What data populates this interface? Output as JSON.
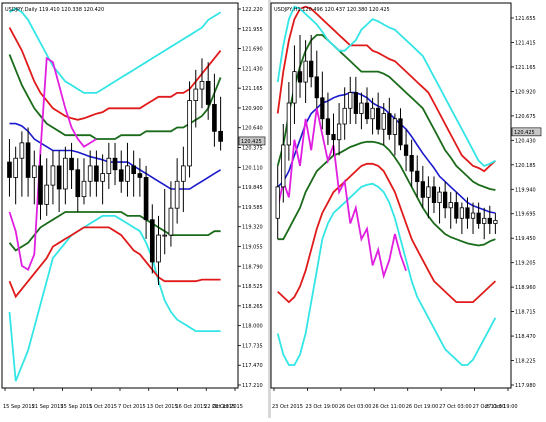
{
  "colors": {
    "background": "#ffffff",
    "frame": "#000000",
    "separator": "#d8d8d8",
    "bull_candle": "#ffffff",
    "bear_candle": "#000000",
    "band_outer": "#33e5e5",
    "band_mid": "#e01a1a",
    "band_inner": "#1a6b1a",
    "moving_average": "#1a1acc",
    "lagging_span": "#e01ee0",
    "price_box": "#c8c8c8"
  },
  "chart_data": [
    {
      "type": "line",
      "instrument_label": "USDJPY,Daily 119.410 120.338 120.420",
      "y_ticks": [
        "122.220",
        "121.955",
        "121.690",
        "121.430",
        "121.165",
        "120.900",
        "120.640",
        "120.375",
        "120.110",
        "119.845",
        "119.585",
        "119.320",
        "119.055",
        "118.790",
        "118.525",
        "118.265",
        "118.000",
        "117.735",
        "117.470",
        "117.210"
      ],
      "ylim": [
        117.21,
        122.22
      ],
      "x_ticks": [
        "15 Sep 2015",
        "21 Sep 2015",
        "25 Sep 2015",
        "1 Oct 2015",
        "7 Oct 2015",
        "13 Oct 2015",
        "16 Oct 2015",
        "22 Oct 2015",
        "28 Oct 2015"
      ],
      "current_price": "120.425",
      "candles": {
        "open": [
          120.15,
          119.95,
          120.2,
          120.4,
          119.95,
          120.1,
          119.6,
          119.85,
          120.1,
          119.8,
          120.2,
          120.05,
          119.7,
          119.9,
          120.1,
          119.9,
          120.0,
          120.2,
          120.05,
          119.9,
          120.1,
          120.0,
          119.95,
          119.4,
          118.85,
          119.2,
          119.2,
          119.55,
          119.9,
          120.1,
          120.95,
          121.1,
          121.2,
          120.9,
          120.55
        ],
        "high": [
          120.45,
          120.35,
          120.55,
          120.6,
          120.3,
          120.25,
          120.2,
          120.3,
          120.3,
          120.35,
          120.4,
          120.2,
          120.2,
          120.3,
          120.3,
          120.25,
          120.4,
          120.4,
          120.3,
          120.4,
          120.3,
          120.2,
          120.1,
          119.6,
          119.45,
          119.8,
          119.9,
          120.2,
          120.35,
          121.2,
          121.35,
          121.5,
          121.45,
          121.3,
          121.0
        ],
        "low": [
          119.7,
          119.6,
          119.7,
          119.7,
          119.6,
          119.4,
          119.45,
          119.6,
          119.5,
          119.6,
          119.8,
          119.5,
          119.6,
          119.7,
          119.7,
          119.6,
          119.8,
          119.85,
          119.75,
          119.7,
          119.7,
          119.7,
          119.15,
          118.7,
          118.55,
          118.95,
          119.05,
          119.35,
          119.5,
          119.95,
          120.6,
          120.85,
          120.7,
          120.35,
          120.3
        ],
        "close": [
          119.95,
          120.2,
          120.4,
          119.95,
          120.1,
          119.6,
          119.85,
          120.1,
          119.8,
          120.2,
          120.05,
          119.7,
          119.9,
          120.1,
          119.9,
          120.0,
          120.2,
          120.05,
          119.9,
          120.1,
          120.0,
          119.95,
          119.4,
          118.85,
          119.2,
          119.2,
          119.55,
          119.9,
          120.1,
          120.95,
          121.1,
          121.2,
          120.9,
          120.55,
          120.42
        ]
      },
      "series": [
        {
          "name": "",
          "role": "band_outer",
          "values": [
            118.2,
            117.3,
            117.5,
            117.7,
            118.0,
            118.3,
            118.6,
            118.9,
            119.0,
            119.1,
            119.2,
            119.25,
            119.3,
            119.35,
            119.4,
            119.45,
            119.45,
            119.45,
            119.4,
            119.35,
            119.3,
            119.25,
            119.1,
            118.9,
            118.6,
            118.35,
            118.2,
            118.1,
            118.05,
            118.0,
            117.95,
            117.95,
            117.95,
            117.95,
            117.95
          ]
        },
        {
          "name": "",
          "role": "band_mid",
          "values": [
            118.6,
            118.4,
            118.5,
            118.6,
            118.7,
            118.8,
            118.9,
            119.05,
            119.1,
            119.15,
            119.2,
            119.25,
            119.3,
            119.3,
            119.3,
            119.3,
            119.3,
            119.25,
            119.2,
            119.1,
            119.0,
            118.95,
            118.85,
            118.75,
            118.65,
            118.6,
            118.6,
            118.6,
            118.6,
            118.6,
            118.6,
            118.62,
            118.62,
            118.62,
            118.62
          ]
        },
        {
          "name": "",
          "role": "band_inner",
          "values": [
            119.1,
            119.0,
            119.05,
            119.1,
            119.2,
            119.3,
            119.35,
            119.4,
            119.45,
            119.5,
            119.5,
            119.5,
            119.5,
            119.5,
            119.5,
            119.5,
            119.5,
            119.5,
            119.5,
            119.45,
            119.45,
            119.45,
            119.4,
            119.35,
            119.3,
            119.25,
            119.2,
            119.2,
            119.2,
            119.2,
            119.2,
            119.2,
            119.2,
            119.25,
            119.25
          ]
        },
        {
          "name": "",
          "role": "moving_average",
          "values": [
            120.65,
            120.65,
            120.62,
            120.55,
            120.45,
            120.4,
            120.35,
            120.3,
            120.3,
            120.3,
            120.3,
            120.28,
            120.25,
            120.22,
            120.2,
            120.18,
            120.15,
            120.15,
            120.15,
            120.15,
            120.1,
            120.05,
            120.0,
            119.95,
            119.9,
            119.85,
            119.8,
            119.8,
            119.8,
            119.8,
            119.85,
            119.9,
            119.95,
            120.0,
            120.05
          ]
        },
        {
          "name": "",
          "role": "band_inner",
          "values": [
            121.55,
            121.35,
            121.15,
            121.0,
            120.85,
            120.75,
            120.65,
            120.6,
            120.55,
            120.5,
            120.5,
            120.5,
            120.5,
            120.5,
            120.45,
            120.45,
            120.45,
            120.45,
            120.5,
            120.5,
            120.5,
            120.5,
            120.55,
            120.55,
            120.55,
            120.55,
            120.55,
            120.6,
            120.6,
            120.65,
            120.7,
            120.75,
            120.85,
            121.05,
            121.25
          ]
        },
        {
          "name": "",
          "role": "band_mid",
          "values": [
            121.9,
            121.75,
            121.6,
            121.4,
            121.2,
            121.05,
            120.95,
            120.85,
            120.8,
            120.75,
            120.72,
            120.7,
            120.72,
            120.75,
            120.78,
            120.8,
            120.85,
            120.85,
            120.85,
            120.85,
            120.85,
            120.85,
            120.9,
            120.95,
            121.0,
            121.0,
            121.0,
            121.05,
            121.05,
            121.1,
            121.2,
            121.3,
            121.4,
            121.5,
            121.6
          ]
        },
        {
          "name": "",
          "role": "band_outer",
          "values": [
            122.1,
            122.15,
            122.1,
            122.0,
            121.85,
            121.7,
            121.55,
            121.4,
            121.3,
            121.2,
            121.15,
            121.1,
            121.05,
            121.05,
            121.05,
            121.1,
            121.15,
            121.2,
            121.25,
            121.3,
            121.35,
            121.4,
            121.45,
            121.5,
            121.55,
            121.6,
            121.65,
            121.7,
            121.75,
            121.8,
            121.85,
            121.9,
            122.0,
            122.05,
            122.1
          ]
        }
      ],
      "lagging_span": [
        119.5,
        119.25,
        118.8,
        118.75,
        118.95,
        120.3,
        121.5,
        121.45,
        121.15,
        120.85,
        120.6,
        120.45,
        120.35,
        120.4,
        120.45
      ]
    },
    {
      "type": "line",
      "instrument_label": "USDJPY,H1 120.496 120.437 120.380 120.425",
      "y_ticks": [
        "121.655",
        "121.415",
        "121.165",
        "120.920",
        "120.675",
        "120.430",
        "120.185",
        "119.940",
        "119.695",
        "119.450",
        "119.205",
        "118.960",
        "118.715",
        "118.470",
        "118.225",
        "117.980"
      ],
      "ylim": [
        117.98,
        121.655
      ],
      "x_ticks": [
        "23 Oct 2015",
        "23 Oct 19:00",
        "26 Oct 03:00",
        "26 Oct 11:00",
        "26 Oct 19:00",
        "27 Oct 03:00",
        "27 Oct 11:00",
        "27 Oct 19:00"
      ],
      "current_price": "120.425",
      "candles": {
        "open": [
          119.6,
          119.9,
          120.3,
          120.7,
          121.0,
          120.9,
          121.1,
          120.95,
          120.75,
          120.55,
          120.4,
          120.35,
          120.5,
          120.65,
          120.8,
          120.6,
          120.7,
          120.55,
          120.65,
          120.45,
          120.6,
          120.4,
          120.55,
          120.3,
          120.2,
          120.05,
          119.95,
          119.8,
          119.9,
          119.75,
          119.85,
          119.7,
          119.75,
          119.6,
          119.7,
          119.6,
          119.65,
          119.55,
          119.6,
          119.55
        ],
        "high": [
          120.1,
          120.5,
          120.9,
          121.25,
          121.35,
          121.3,
          121.35,
          121.2,
          121.0,
          120.8,
          120.6,
          120.7,
          120.85,
          120.95,
          120.95,
          120.8,
          120.85,
          120.75,
          120.8,
          120.7,
          120.75,
          120.6,
          120.65,
          120.45,
          120.35,
          120.2,
          120.1,
          120.0,
          120.0,
          119.9,
          119.95,
          119.85,
          119.85,
          119.75,
          119.8,
          119.75,
          119.75,
          119.7,
          119.72,
          119.65
        ],
        "low": [
          119.4,
          119.75,
          120.15,
          120.5,
          120.75,
          120.7,
          120.85,
          120.65,
          120.45,
          120.3,
          120.2,
          120.2,
          120.35,
          120.5,
          120.5,
          120.45,
          120.5,
          120.4,
          120.4,
          120.3,
          120.35,
          120.2,
          120.25,
          120.05,
          119.9,
          119.8,
          119.7,
          119.6,
          119.65,
          119.55,
          119.6,
          119.5,
          119.55,
          119.45,
          119.5,
          119.45,
          119.5,
          119.4,
          119.45,
          119.45
        ],
        "close": [
          119.9,
          120.3,
          120.7,
          121.0,
          120.9,
          121.1,
          120.95,
          120.75,
          120.55,
          120.4,
          120.35,
          120.5,
          120.65,
          120.8,
          120.6,
          120.7,
          120.55,
          120.65,
          120.45,
          120.6,
          120.4,
          120.55,
          120.3,
          120.2,
          120.05,
          119.95,
          119.8,
          119.9,
          119.75,
          119.85,
          119.7,
          119.75,
          119.6,
          119.7,
          119.6,
          119.65,
          119.55,
          119.6,
          119.55,
          119.58
        ]
      },
      "series": [
        {
          "name": "",
          "role": "band_outer",
          "values": [
            118.5,
            118.3,
            118.2,
            118.2,
            118.3,
            118.5,
            118.8,
            119.1,
            119.4,
            119.55,
            119.65,
            119.7,
            119.75,
            119.8,
            119.85,
            119.9,
            119.92,
            119.93,
            119.9,
            119.85,
            119.75,
            119.6,
            119.4,
            119.2,
            119.0,
            118.85,
            118.75,
            118.65,
            118.55,
            118.45,
            118.35,
            118.3,
            118.25,
            118.2,
            118.2,
            118.25,
            118.35,
            118.45,
            118.55,
            118.65
          ]
        },
        {
          "name": "",
          "role": "band_mid",
          "values": [
            118.9,
            118.85,
            118.8,
            118.85,
            118.95,
            119.1,
            119.3,
            119.5,
            119.65,
            119.75,
            119.85,
            119.9,
            119.95,
            120.0,
            120.05,
            120.1,
            120.12,
            120.12,
            120.1,
            120.05,
            119.95,
            119.85,
            119.7,
            119.55,
            119.4,
            119.3,
            119.2,
            119.1,
            119.0,
            118.95,
            118.9,
            118.85,
            118.8,
            118.8,
            118.8,
            118.8,
            118.85,
            118.9,
            118.95,
            119.0
          ]
        },
        {
          "name": "",
          "role": "band_inner",
          "values": [
            119.4,
            119.4,
            119.5,
            119.6,
            119.7,
            119.85,
            119.95,
            120.05,
            120.1,
            120.15,
            120.2,
            120.22,
            120.25,
            120.28,
            120.3,
            120.32,
            120.33,
            120.33,
            120.32,
            120.3,
            120.25,
            120.18,
            120.1,
            120.0,
            119.9,
            119.8,
            119.7,
            119.62,
            119.55,
            119.5,
            119.45,
            119.42,
            119.4,
            119.38,
            119.36,
            119.35,
            119.34,
            119.35,
            119.38,
            119.4
          ]
        },
        {
          "name": "",
          "role": "moving_average",
          "values": [
            119.9,
            119.95,
            120.05,
            120.2,
            120.35,
            120.5,
            120.6,
            120.65,
            120.7,
            120.72,
            120.75,
            120.77,
            120.78,
            120.8,
            120.8,
            120.78,
            120.75,
            120.7,
            120.67,
            120.65,
            120.6,
            120.55,
            120.5,
            120.45,
            120.38,
            120.3,
            120.22,
            120.15,
            120.08,
            120.0,
            119.95,
            119.9,
            119.85,
            119.8,
            119.75,
            119.72,
            119.7,
            119.68,
            119.66,
            119.65
          ]
        },
        {
          "name": "",
          "role": "band_inner",
          "values": [
            120.1,
            120.3,
            120.6,
            120.85,
            121.05,
            121.2,
            121.3,
            121.35,
            121.35,
            121.3,
            121.25,
            121.2,
            121.15,
            121.1,
            121.05,
            121.0,
            121.0,
            121.0,
            121.0,
            120.98,
            120.95,
            120.9,
            120.85,
            120.8,
            120.75,
            120.7,
            120.65,
            120.55,
            120.45,
            120.35,
            120.25,
            120.18,
            120.1,
            120.05,
            120.0,
            119.95,
            119.92,
            119.9,
            119.88,
            119.87
          ]
        },
        {
          "name": "",
          "role": "band_mid",
          "values": [
            120.6,
            121.0,
            121.3,
            121.5,
            121.6,
            121.62,
            121.6,
            121.55,
            121.5,
            121.45,
            121.4,
            121.35,
            121.3,
            121.25,
            121.25,
            121.25,
            121.25,
            121.2,
            121.18,
            121.15,
            121.12,
            121.1,
            121.05,
            121.0,
            120.95,
            120.9,
            120.85,
            120.8,
            120.7,
            120.6,
            120.5,
            120.4,
            120.3,
            120.2,
            120.15,
            120.1,
            120.08,
            120.05,
            120.1,
            120.15
          ]
        },
        {
          "name": "",
          "role": "band_outer",
          "values": [
            120.9,
            121.25,
            121.5,
            121.62,
            121.6,
            121.55,
            121.5,
            121.45,
            121.38,
            121.3,
            121.25,
            121.2,
            121.2,
            121.25,
            121.3,
            121.4,
            121.45,
            121.5,
            121.48,
            121.45,
            121.42,
            121.4,
            121.35,
            121.3,
            121.25,
            121.2,
            121.15,
            121.05,
            120.95,
            120.85,
            120.75,
            120.65,
            120.55,
            120.45,
            120.35,
            120.25,
            120.15,
            120.1,
            120.12,
            120.15
          ]
        }
      ],
      "lagging_span": [
        119.7,
        119.95,
        119.8,
        120.35,
        120.1,
        120.55,
        120.25,
        120.65,
        120.4,
        120.15,
        120.3,
        119.85,
        119.95,
        119.55,
        119.7,
        119.4,
        119.5,
        119.15,
        119.3,
        119.05,
        119.2,
        119.45,
        119.25,
        119.1
      ]
    }
  ]
}
